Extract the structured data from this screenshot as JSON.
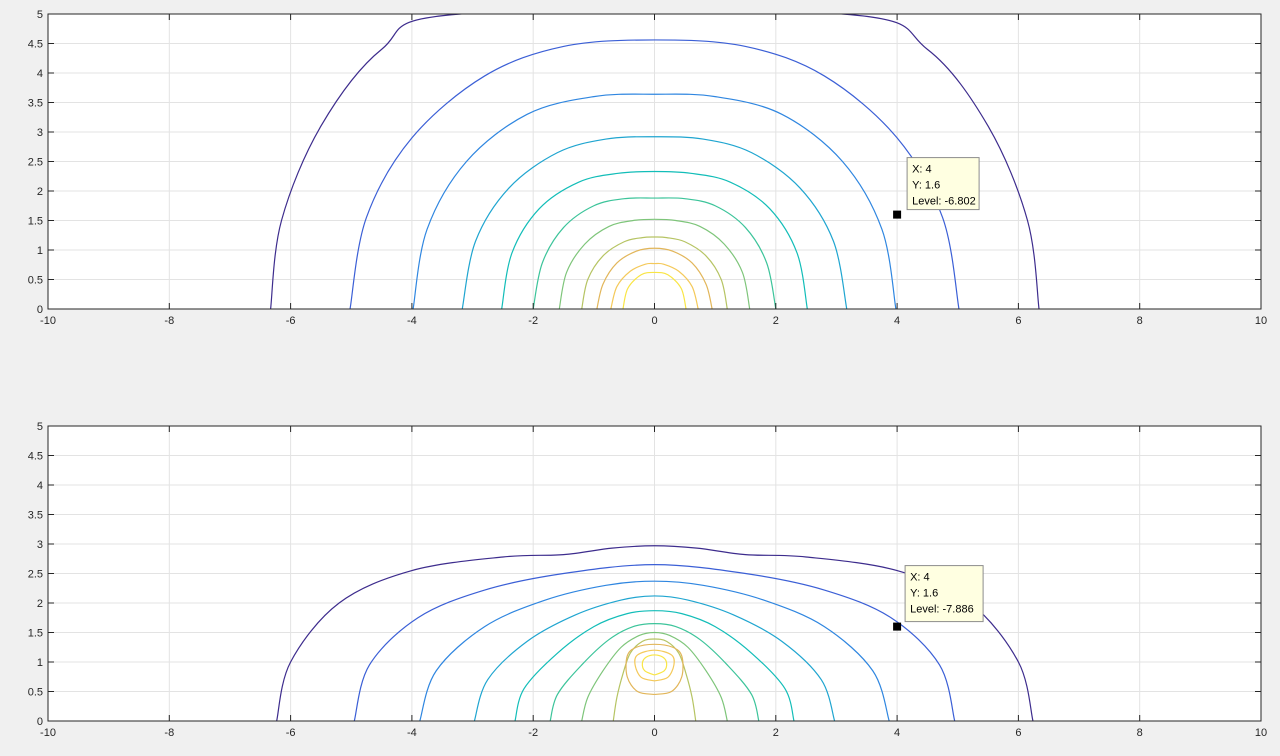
{
  "chart_data": [
    {
      "type": "contour",
      "xlim": [
        -10,
        10
      ],
      "ylim": [
        0,
        5
      ],
      "xticks": [
        -10,
        -8,
        -6,
        -4,
        -2,
        0,
        2,
        4,
        6,
        8,
        10
      ],
      "yticks": [
        0,
        0.5,
        1,
        1.5,
        2,
        2.5,
        3,
        3.5,
        4,
        4.5,
        5
      ],
      "grid": true,
      "contours": [
        {
          "color": "#3d2c8d",
          "points": [
            [
              -6.33,
              0
            ],
            [
              -6.15,
              1.5
            ],
            [
              -5.5,
              3.1
            ],
            [
              -4.5,
              4.4
            ],
            [
              -3.2,
              5.0
            ],
            [
              3.1,
              5.0
            ],
            [
              4.5,
              4.4
            ],
            [
              5.5,
              3.1
            ],
            [
              6.15,
              1.5
            ],
            [
              6.34,
              0
            ]
          ]
        },
        {
          "color": "#3b5fd6",
          "points": [
            [
              -5.02,
              0
            ],
            [
              -4.75,
              1.55
            ],
            [
              -4.0,
              2.9
            ],
            [
              -2.8,
              3.95
            ],
            [
              -1.5,
              4.45
            ],
            [
              0,
              4.56
            ],
            [
              1.5,
              4.45
            ],
            [
              2.8,
              3.95
            ],
            [
              4.0,
              2.9
            ],
            [
              4.75,
              1.55
            ],
            [
              5.02,
              0
            ]
          ]
        },
        {
          "color": "#2f86e0",
          "points": [
            [
              -3.98,
              0
            ],
            [
              -3.75,
              1.35
            ],
            [
              -3.1,
              2.5
            ],
            [
              -2.1,
              3.3
            ],
            [
              -1.0,
              3.6
            ],
            [
              0,
              3.64
            ],
            [
              1.0,
              3.6
            ],
            [
              2.1,
              3.3
            ],
            [
              3.1,
              2.5
            ],
            [
              3.75,
              1.35
            ],
            [
              3.98,
              0
            ]
          ]
        },
        {
          "color": "#1fa5d0",
          "points": [
            [
              -3.17,
              0
            ],
            [
              -2.95,
              1.15
            ],
            [
              -2.4,
              2.05
            ],
            [
              -1.6,
              2.65
            ],
            [
              -0.8,
              2.88
            ],
            [
              0,
              2.92
            ],
            [
              0.8,
              2.88
            ],
            [
              1.6,
              2.65
            ],
            [
              2.4,
              2.05
            ],
            [
              2.95,
              1.15
            ],
            [
              3.17,
              0
            ]
          ]
        },
        {
          "color": "#12bdb8",
          "points": [
            [
              -2.52,
              0
            ],
            [
              -2.35,
              0.95
            ],
            [
              -1.9,
              1.7
            ],
            [
              -1.25,
              2.15
            ],
            [
              -0.6,
              2.3
            ],
            [
              0,
              2.33
            ],
            [
              0.6,
              2.3
            ],
            [
              1.25,
              2.15
            ],
            [
              1.9,
              1.7
            ],
            [
              2.35,
              0.95
            ],
            [
              2.52,
              0
            ]
          ]
        },
        {
          "color": "#3cc49a",
          "points": [
            [
              -2.0,
              0
            ],
            [
              -1.85,
              0.78
            ],
            [
              -1.5,
              1.38
            ],
            [
              -1.0,
              1.75
            ],
            [
              -0.5,
              1.87
            ],
            [
              0,
              1.88
            ],
            [
              0.5,
              1.87
            ],
            [
              1.0,
              1.75
            ],
            [
              1.5,
              1.38
            ],
            [
              1.85,
              0.78
            ],
            [
              2.0,
              0
            ]
          ]
        },
        {
          "color": "#7ec57a",
          "points": [
            [
              -1.57,
              0
            ],
            [
              -1.45,
              0.62
            ],
            [
              -1.15,
              1.1
            ],
            [
              -0.75,
              1.4
            ],
            [
              -0.35,
              1.5
            ],
            [
              0,
              1.52
            ],
            [
              0.35,
              1.5
            ],
            [
              0.75,
              1.4
            ],
            [
              1.15,
              1.1
            ],
            [
              1.45,
              0.62
            ],
            [
              1.57,
              0
            ]
          ]
        },
        {
          "color": "#b6c463",
          "points": [
            [
              -1.2,
              0
            ],
            [
              -1.1,
              0.5
            ],
            [
              -0.85,
              0.9
            ],
            [
              -0.5,
              1.14
            ],
            [
              -0.2,
              1.21
            ],
            [
              0,
              1.22
            ],
            [
              0.2,
              1.21
            ],
            [
              0.5,
              1.14
            ],
            [
              0.85,
              0.9
            ],
            [
              1.1,
              0.5
            ],
            [
              1.2,
              0
            ]
          ]
        },
        {
          "color": "#e2b65a",
          "points": [
            [
              -0.95,
              0
            ],
            [
              -0.85,
              0.42
            ],
            [
              -0.62,
              0.78
            ],
            [
              -0.3,
              0.98
            ],
            [
              0,
              1.03
            ],
            [
              0.3,
              0.98
            ],
            [
              0.62,
              0.78
            ],
            [
              0.85,
              0.42
            ],
            [
              0.95,
              0
            ]
          ]
        },
        {
          "color": "#f4c95a",
          "points": [
            [
              -0.72,
              0
            ],
            [
              -0.62,
              0.38
            ],
            [
              -0.4,
              0.64
            ],
            [
              -0.15,
              0.76
            ],
            [
              0,
              0.77
            ],
            [
              0.15,
              0.76
            ],
            [
              0.4,
              0.64
            ],
            [
              0.62,
              0.38
            ],
            [
              0.72,
              0
            ]
          ]
        },
        {
          "color": "#f9e544",
          "points": [
            [
              -0.52,
              0
            ],
            [
              -0.44,
              0.35
            ],
            [
              -0.22,
              0.58
            ],
            [
              0,
              0.62
            ],
            [
              0.22,
              0.58
            ],
            [
              0.44,
              0.35
            ],
            [
              0.52,
              0
            ]
          ]
        }
      ],
      "datatip": {
        "x": 4,
        "y": 1.6,
        "labels": [
          "X: 4",
          "Y: 1.6",
          "Level: -6.802"
        ]
      }
    },
    {
      "type": "contour",
      "xlim": [
        -10,
        10
      ],
      "ylim": [
        0,
        5
      ],
      "xticks": [
        -10,
        -8,
        -6,
        -4,
        -2,
        0,
        2,
        4,
        6,
        8,
        10
      ],
      "yticks": [
        0,
        0.5,
        1,
        1.5,
        2,
        2.5,
        3,
        3.5,
        4,
        4.5,
        5
      ],
      "grid": true,
      "contours": [
        {
          "color": "#3d2c8d",
          "points": [
            [
              -6.23,
              0
            ],
            [
              -6.0,
              1.0
            ],
            [
              -5.2,
              2.0
            ],
            [
              -4.0,
              2.55
            ],
            [
              -2.5,
              2.78
            ],
            [
              -1.5,
              2.82
            ],
            [
              -0.7,
              2.93
            ],
            [
              0,
              2.97
            ],
            [
              0.7,
              2.93
            ],
            [
              1.5,
              2.82
            ],
            [
              2.5,
              2.78
            ],
            [
              4.0,
              2.55
            ],
            [
              5.2,
              2.0
            ],
            [
              6.0,
              1.0
            ],
            [
              6.24,
              0
            ]
          ]
        },
        {
          "color": "#3b5fd6",
          "points": [
            [
              -4.95,
              0
            ],
            [
              -4.7,
              0.95
            ],
            [
              -3.9,
              1.75
            ],
            [
              -2.8,
              2.22
            ],
            [
              -1.5,
              2.5
            ],
            [
              0,
              2.65
            ],
            [
              1.5,
              2.5
            ],
            [
              2.8,
              2.22
            ],
            [
              3.9,
              1.75
            ],
            [
              4.7,
              0.95
            ],
            [
              4.95,
              0
            ]
          ]
        },
        {
          "color": "#2f86e0",
          "points": [
            [
              -3.87,
              0
            ],
            [
              -3.6,
              0.85
            ],
            [
              -2.8,
              1.6
            ],
            [
              -1.8,
              2.05
            ],
            [
              -0.8,
              2.3
            ],
            [
              0,
              2.37
            ],
            [
              0.8,
              2.3
            ],
            [
              1.8,
              2.05
            ],
            [
              2.8,
              1.6
            ],
            [
              3.6,
              0.85
            ],
            [
              3.87,
              0
            ]
          ]
        },
        {
          "color": "#1fa5d0",
          "points": [
            [
              -2.97,
              0
            ],
            [
              -2.75,
              0.7
            ],
            [
              -2.1,
              1.35
            ],
            [
              -1.3,
              1.8
            ],
            [
              -0.55,
              2.05
            ],
            [
              0,
              2.12
            ],
            [
              0.55,
              2.05
            ],
            [
              1.3,
              1.8
            ],
            [
              2.1,
              1.35
            ],
            [
              2.75,
              0.7
            ],
            [
              2.97,
              0
            ]
          ]
        },
        {
          "color": "#12bdb8",
          "points": [
            [
              -2.3,
              0
            ],
            [
              -2.15,
              0.55
            ],
            [
              -1.6,
              1.15
            ],
            [
              -1.0,
              1.6
            ],
            [
              -0.45,
              1.82
            ],
            [
              0,
              1.87
            ],
            [
              0.45,
              1.82
            ],
            [
              1.0,
              1.6
            ],
            [
              1.6,
              1.15
            ],
            [
              2.15,
              0.55
            ],
            [
              2.3,
              0
            ]
          ]
        },
        {
          "color": "#3cc49a",
          "points": [
            [
              -1.72,
              0
            ],
            [
              -1.6,
              0.45
            ],
            [
              -1.2,
              0.95
            ],
            [
              -0.75,
              1.38
            ],
            [
              -0.35,
              1.6
            ],
            [
              0,
              1.65
            ],
            [
              0.35,
              1.6
            ],
            [
              0.75,
              1.38
            ],
            [
              1.2,
              0.95
            ],
            [
              1.6,
              0.45
            ],
            [
              1.72,
              0
            ]
          ]
        },
        {
          "color": "#7ec57a",
          "points": [
            [
              -1.2,
              0
            ],
            [
              -1.1,
              0.4
            ],
            [
              -0.85,
              0.85
            ],
            [
              -0.55,
              1.25
            ],
            [
              -0.25,
              1.45
            ],
            [
              0,
              1.5
            ],
            [
              0.25,
              1.45
            ],
            [
              0.55,
              1.25
            ],
            [
              0.85,
              0.85
            ],
            [
              1.1,
              0.4
            ],
            [
              1.2,
              0
            ]
          ]
        },
        {
          "color": "#b6c463",
          "points": [
            [
              -0.68,
              0
            ],
            [
              -0.62,
              0.4
            ],
            [
              -0.52,
              0.8
            ],
            [
              -0.4,
              1.15
            ],
            [
              -0.2,
              1.35
            ],
            [
              0,
              1.39
            ],
            [
              0.2,
              1.35
            ],
            [
              0.4,
              1.15
            ],
            [
              0.52,
              0.8
            ],
            [
              0.62,
              0.4
            ],
            [
              0.68,
              0
            ]
          ]
        },
        {
          "color": "#e2b65a",
          "points": [
            [
              0,
              0.45
            ],
            [
              0.28,
              0.5
            ],
            [
              0.45,
              0.75
            ],
            [
              0.45,
              1.1
            ],
            [
              0.3,
              1.25
            ],
            [
              0,
              1.3
            ],
            [
              -0.3,
              1.25
            ],
            [
              -0.45,
              1.1
            ],
            [
              -0.45,
              0.75
            ],
            [
              -0.28,
              0.5
            ],
            [
              0,
              0.45
            ]
          ]
        },
        {
          "color": "#f4c95a",
          "points": [
            [
              0,
              0.68
            ],
            [
              0.22,
              0.74
            ],
            [
              0.32,
              0.95
            ],
            [
              0.28,
              1.12
            ],
            [
              0,
              1.2
            ],
            [
              -0.28,
              1.12
            ],
            [
              -0.32,
              0.95
            ],
            [
              -0.22,
              0.74
            ],
            [
              0,
              0.68
            ]
          ]
        },
        {
          "color": "#f9e544",
          "points": [
            [
              0,
              0.78
            ],
            [
              0.16,
              0.85
            ],
            [
              0.2,
              0.98
            ],
            [
              0.14,
              1.08
            ],
            [
              0,
              1.12
            ],
            [
              -0.14,
              1.08
            ],
            [
              -0.2,
              0.98
            ],
            [
              -0.16,
              0.85
            ],
            [
              0,
              0.78
            ]
          ]
        }
      ],
      "datatip": {
        "x": 4,
        "y": 1.6,
        "labels": [
          "X: 4",
          "Y: 1.6",
          "Level: -7.886"
        ]
      }
    }
  ]
}
